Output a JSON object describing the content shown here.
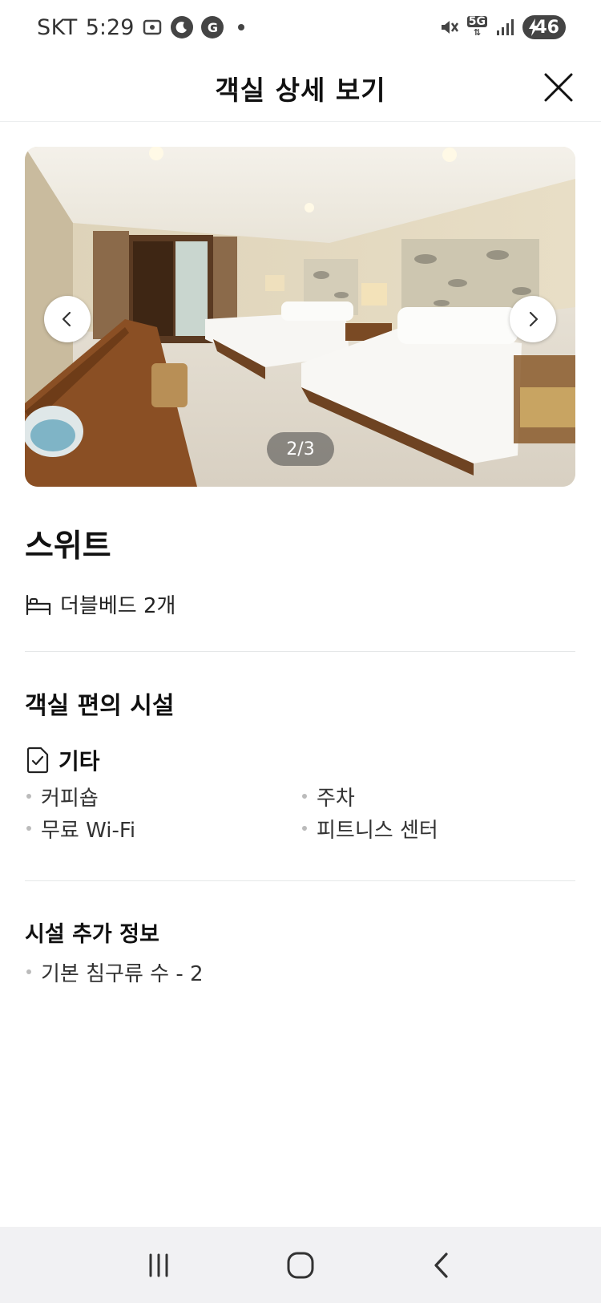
{
  "status_bar": {
    "carrier": "SKT",
    "time": "5:29",
    "network": "5G",
    "battery": "46"
  },
  "header": {
    "title": "객실 상세 보기"
  },
  "gallery": {
    "counter": "2/3"
  },
  "room": {
    "name": "스위트",
    "bed": "더블베드 2개"
  },
  "amenities": {
    "title": "객실 편의 시설",
    "category": "기타",
    "items": [
      "커피숍",
      "주차",
      "무료 Wi-Fi",
      "피트니스 센터"
    ]
  },
  "extra_info": {
    "title": "시설 추가 정보",
    "items": [
      "기본 침구류 수 - 2"
    ]
  },
  "colors": {
    "text_primary": "#111111",
    "divider": "#e5e7e8",
    "navbar_bg": "#f1f1f3"
  }
}
